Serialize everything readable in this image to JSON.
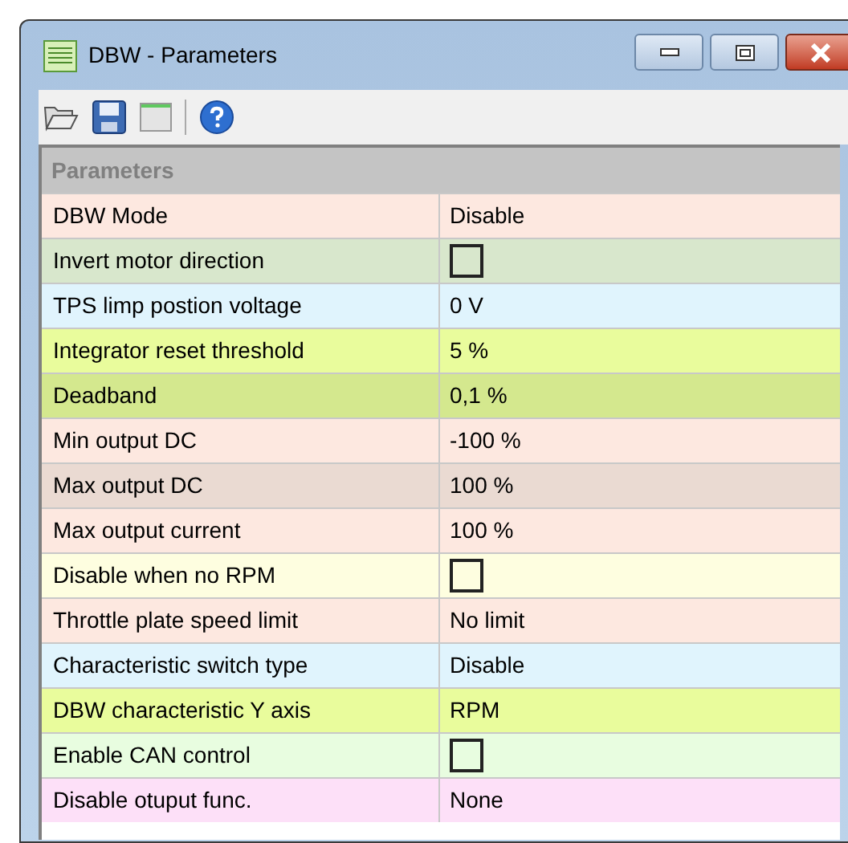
{
  "window": {
    "title": "DBW - Parameters"
  },
  "grid": {
    "header": "Parameters",
    "rows": [
      {
        "label": "DBW Mode",
        "kind": "text",
        "value": "Disable",
        "color": "#fde8e0"
      },
      {
        "label": "Invert motor direction",
        "kind": "checkbox",
        "checked": false,
        "color": "#d8e7cc"
      },
      {
        "label": "TPS limp postion voltage",
        "kind": "text",
        "value": "0 V",
        "color": "#e0f4fd"
      },
      {
        "label": "Integrator reset threshold",
        "kind": "text",
        "value": "5 %",
        "color": "#e9fc9c"
      },
      {
        "label": "Deadband",
        "kind": "text",
        "value": "0,1 %",
        "color": "#d4e88e"
      },
      {
        "label": "Min output DC",
        "kind": "text",
        "value": "-100 %",
        "color": "#fde8e0"
      },
      {
        "label": "Max output DC",
        "kind": "text",
        "value": "100 %",
        "color": "#eadad2"
      },
      {
        "label": "Max output current",
        "kind": "text",
        "value": "100 %",
        "color": "#fde8e0"
      },
      {
        "label": "Disable when no RPM",
        "kind": "checkbox",
        "checked": false,
        "color": "#fefee0"
      },
      {
        "label": "Throttle plate speed limit",
        "kind": "text",
        "value": "No limit",
        "color": "#fde8e0"
      },
      {
        "label": "Characteristic switch type",
        "kind": "text",
        "value": "Disable",
        "color": "#e0f4fd"
      },
      {
        "label": "DBW characteristic Y axis",
        "kind": "text",
        "value": "RPM",
        "color": "#e9fc9c"
      },
      {
        "label": "Enable CAN control",
        "kind": "checkbox",
        "checked": false,
        "color": "#e8fde0"
      },
      {
        "label": "Disable otuput func.",
        "kind": "text",
        "value": "None",
        "color": "#fde0f8"
      }
    ]
  }
}
